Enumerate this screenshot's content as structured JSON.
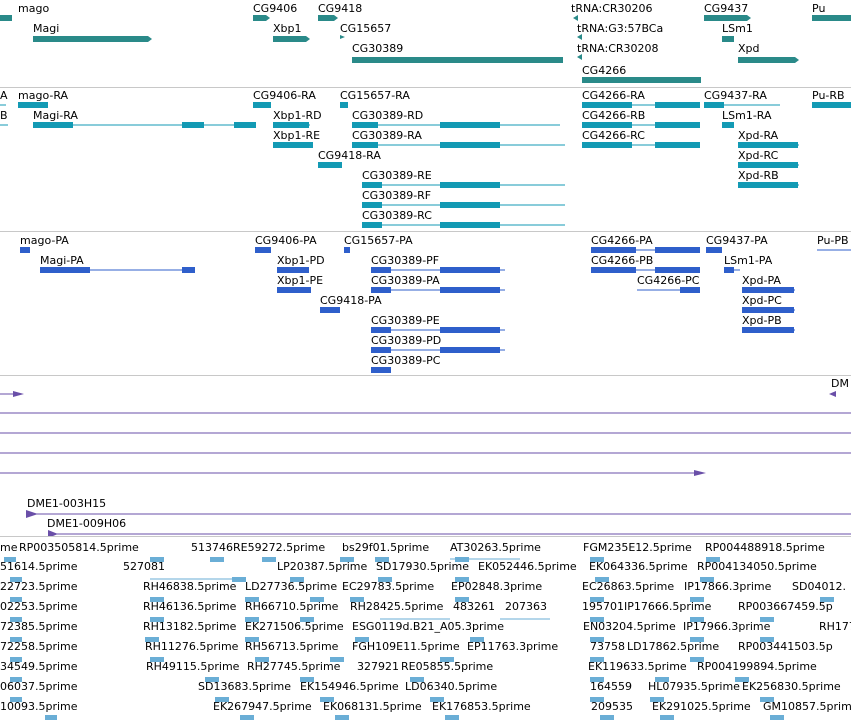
{
  "colors": {
    "gene": "#2a8a89",
    "transcript": "#139ab4",
    "protein": "#2f5fcb",
    "clone": "#6a4fa8",
    "est": "#6aaed6",
    "separator": "#c8c8c8"
  },
  "gene_track": {
    "labels": [
      "mago",
      "Magi",
      "CG9406",
      "Xbp1",
      "CG9418",
      "CG15657",
      "CG30389",
      "tRNA:CR30206",
      "tRNA:G3:57BCa",
      "tRNA:CR30208",
      "CG4266",
      "CG9437",
      "LSm1",
      "Xpd",
      "Pu"
    ]
  },
  "transcript_track": {
    "labels": [
      "A",
      "mago-RA",
      "B",
      "Magi-RA",
      "CG9406-RA",
      "Xbp1-RD",
      "Xbp1-RE",
      "CG9418-RA",
      "CG15657-RA",
      "CG30389-RD",
      "CG30389-RA",
      "CG30389-RE",
      "CG30389-RF",
      "CG30389-RC",
      "CG4266-RA",
      "CG4266-RB",
      "CG4266-RC",
      "CG9437-RA",
      "LSm1-RA",
      "Xpd-RA",
      "Xpd-RC",
      "Xpd-RB",
      "Pu-RB"
    ]
  },
  "protein_track": {
    "labels": [
      "mago-PA",
      "Magi-PA",
      "CG9406-PA",
      "Xbp1-PD",
      "Xbp1-PE",
      "CG9418-PA",
      "CG15657-PA",
      "CG30389-PF",
      "CG30389-PA",
      "CG30389-PE",
      "CG30389-PD",
      "CG30389-PC",
      "CG4266-PA",
      "CG4266-PB",
      "CG4266-PC",
      "CG9437-PA",
      "LSm1-PA",
      "Xpd-PA",
      "Xpd-PC",
      "Xpd-PB",
      "Pu-PB"
    ]
  },
  "clone_track": {
    "labels": [
      "DM",
      "DME1-003H15",
      "DME1-009H06"
    ]
  },
  "est_track": {
    "labels": [
      "ime",
      "RP003505814.5prime",
      "513746RE59272.5prime",
      "bs29f01.5prime",
      "AT30263.5prime",
      "FGM235E12.5prime",
      "RP004488918.5prime",
      "51614.5prime",
      "527081",
      "LP20387.5prime",
      "SD17930.5prime",
      "EK052446.5prime",
      "EK064336.5prime",
      "RP004134050.5prime",
      "22723.5prime",
      "RH46838.5prime",
      "LD27736.5prime",
      "EC29783.5prime",
      "EP02848.3prime",
      "EC26863.5prime",
      "IP17866.3prime",
      "SD04012.",
      "02253.5prime",
      "RH46136.5prime",
      "RH66710.5prime",
      "RH28425.5prime",
      "483261",
      "207363",
      "195701",
      "IP17666.5prime",
      "RP003667459.5p",
      "72385.5prime",
      "RH13182.5prime",
      "EK271506.5prime",
      "ESG0119d.B21_A05.3prime",
      "EN03204.5prime",
      "IP17966.3prime",
      "RH177",
      "72258.5prime",
      "RH11276.5prime",
      "RH56713.5prime",
      "FGH109E11.5prime",
      "EP11763.3prime",
      "73758",
      "LD17862.5prime",
      "RP003441503.5p",
      "34549.5prime",
      "RH49115.5prime",
      "RH27745.5prime",
      "327921",
      "RE05855.5prime",
      "EK119633.5prime",
      "RP004199894.5prime",
      "06037.5prime",
      "SD13683.5prime",
      "EK154946.5prime",
      "LD06340.5prime",
      "164559",
      "HL07935.5prime",
      "EK256830.5prime",
      "10093.5prime",
      "EK267947.5prime",
      "EK068131.5prime",
      "EK176853.5prime",
      "209535",
      "EK291025.5prime",
      "GM10857.5prime"
    ]
  }
}
